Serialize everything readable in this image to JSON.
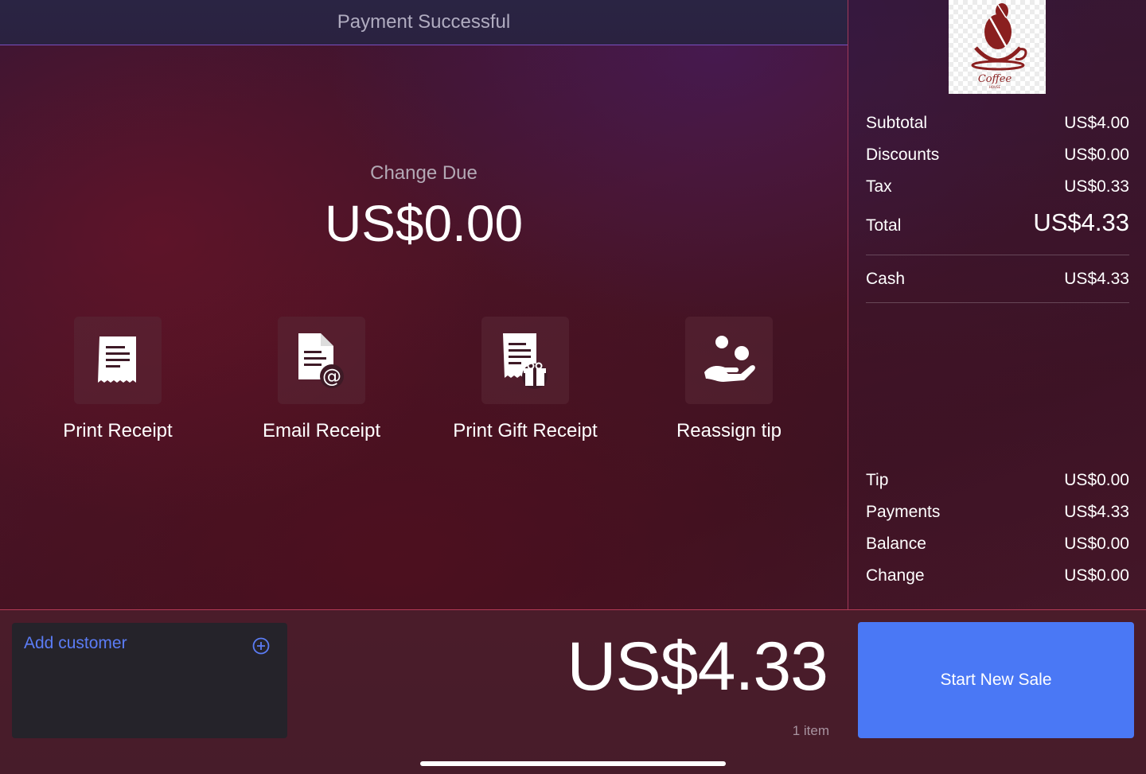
{
  "header": {
    "title": "Payment Successful"
  },
  "change_due": {
    "label": "Change Due",
    "amount": "US$0.00"
  },
  "actions": [
    {
      "label": "Print Receipt",
      "icon": "receipt-icon"
    },
    {
      "label": "Email Receipt",
      "icon": "email-receipt-icon"
    },
    {
      "label": "Print Gift Receipt",
      "icon": "gift-receipt-icon"
    },
    {
      "label": "Reassign tip",
      "icon": "hand-coins-icon"
    }
  ],
  "logo": {
    "text": "Coffee",
    "subtext": "HOUSE"
  },
  "summary": {
    "subtotal": {
      "label": "Subtotal",
      "value": "US$4.00"
    },
    "discounts": {
      "label": "Discounts",
      "value": "US$0.00"
    },
    "tax": {
      "label": "Tax",
      "value": "US$0.33"
    },
    "total": {
      "label": "Total",
      "value": "US$4.33"
    },
    "cash": {
      "label": "Cash",
      "value": "US$4.33"
    },
    "tip": {
      "label": "Tip",
      "value": "US$0.00"
    },
    "payments": {
      "label": "Payments",
      "value": "US$4.33"
    },
    "balance": {
      "label": "Balance",
      "value": "US$0.00"
    },
    "change": {
      "label": "Change",
      "value": "US$0.00"
    }
  },
  "bottom": {
    "add_customer": "Add customer",
    "grand_total": "US$4.33",
    "item_count": "1 item",
    "start_new_sale": "Start New Sale"
  },
  "colors": {
    "accent_blue": "#4a78f5",
    "link_blue": "#5b7cf5",
    "divider_pink": "#b33a55"
  }
}
